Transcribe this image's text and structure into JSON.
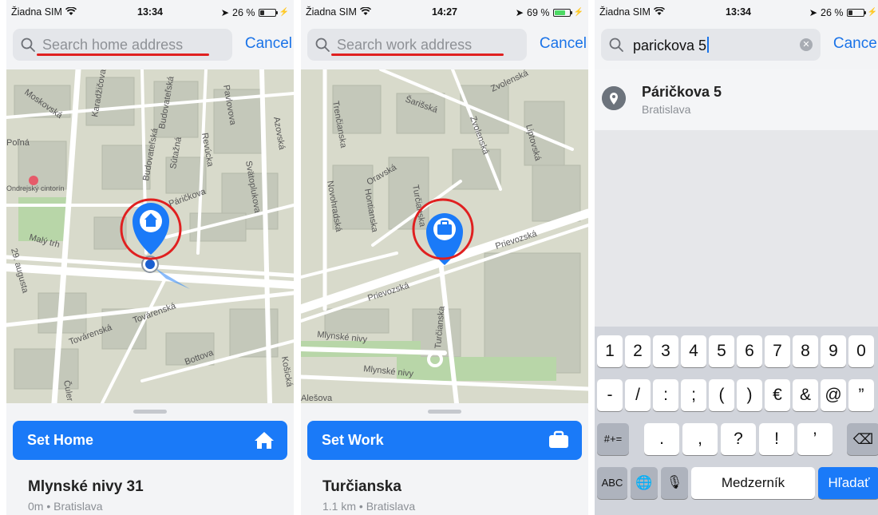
{
  "screens": [
    {
      "status": {
        "carrier": "Žiadna SIM",
        "time": "13:34",
        "battery": "26 %"
      },
      "search": {
        "placeholder": "Search home address",
        "cancel": "Cancel"
      },
      "map_labels": [
        "Moskovská",
        "Karadžičova",
        "Budovateľská",
        "Budovateľská",
        "Pavlovova",
        "Azovská",
        "Sútažná",
        "Revúcka",
        "Svätoplukova",
        "Poľná",
        "Ondrejský cintorín",
        "Páričkova",
        "Malý trh",
        "29. augusta",
        "Továrenská",
        "Továrenská",
        "Bottova",
        "Košická",
        "Čuler"
      ],
      "button": {
        "label": "Set Home",
        "icon": "home-icon"
      },
      "address": {
        "title": "Mlynské nivy 31",
        "subtitle": "0m • Bratislava"
      }
    },
    {
      "status": {
        "carrier": "Žiadna SIM",
        "time": "14:27",
        "battery": "69 %"
      },
      "search": {
        "placeholder": "Search work address",
        "cancel": "Cancel"
      },
      "map_labels": [
        "Zvolenská",
        "Trenčianska",
        "Šarišská",
        "Zvolenská",
        "Liptovská",
        "Oravská",
        "Novohradská",
        "Hontianska",
        "Turčianska",
        "Prievozská",
        "Prievozská",
        "Turčianska",
        "Mlynské nivy",
        "Mlynské nivy",
        "Alešova"
      ],
      "button": {
        "label": "Set Work",
        "icon": "briefcase-icon"
      },
      "address": {
        "title": "Turčianska",
        "subtitle": "1.1 km • Bratislava"
      }
    },
    {
      "status": {
        "carrier": "Žiadna SIM",
        "time": "13:34",
        "battery": "26 %"
      },
      "search": {
        "value": "parickova 5",
        "cancel": "Cancel"
      },
      "result": {
        "title": "Páričkova 5",
        "subtitle": "Bratislava"
      },
      "keyboard": {
        "row1": [
          "1",
          "2",
          "3",
          "4",
          "5",
          "6",
          "7",
          "8",
          "9",
          "0"
        ],
        "row2": [
          "-",
          "/",
          ":",
          ";",
          "(",
          ")",
          "€",
          "&",
          "@",
          "”"
        ],
        "row3": [
          "#+=",
          ".",
          ",",
          "?",
          "!",
          "’",
          "⌫"
        ],
        "row4": [
          "ABC",
          "🌐",
          "🎙",
          "Medzerník",
          "Hľadať"
        ]
      }
    }
  ],
  "colors": {
    "accent": "#1a7af8",
    "highlight_ring": "#e02020"
  }
}
